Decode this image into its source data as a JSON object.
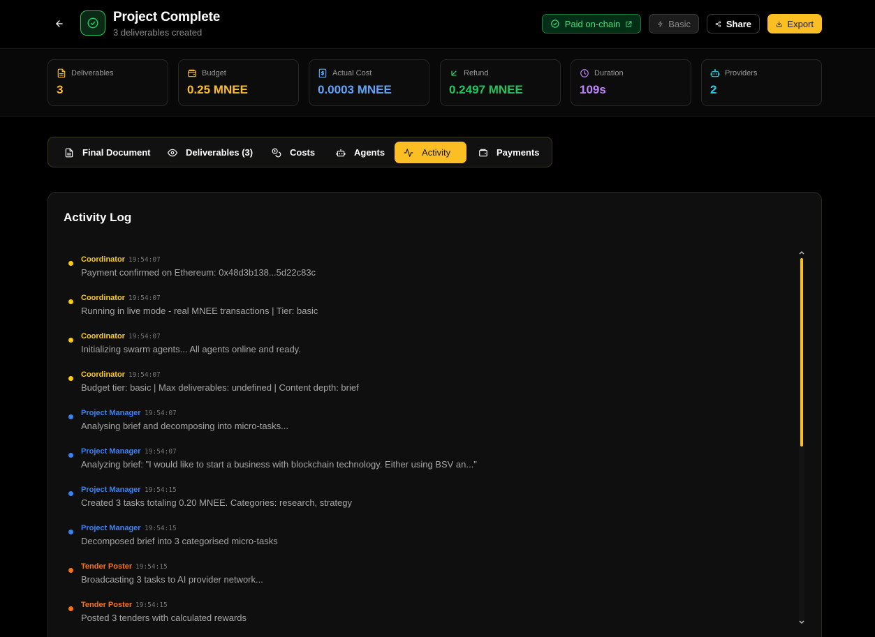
{
  "header": {
    "title": "Project Complete",
    "subtitle": "3 deliverables created",
    "paid_label": "Paid on-chain",
    "basic_label": "Basic",
    "share_label": "Share",
    "export_label": "Export"
  },
  "stats": [
    {
      "label": "Deliverables",
      "value": "3",
      "color": "#fbbf24",
      "icon": "file-icon"
    },
    {
      "label": "Budget",
      "value": "0.25 MNEE",
      "color": "#fbbf24",
      "icon": "wallet-icon"
    },
    {
      "label": "Actual Cost",
      "value": "0.0003 MNEE",
      "color": "#60a5fa",
      "icon": "receipt-icon"
    },
    {
      "label": "Refund",
      "value": "0.2497 MNEE",
      "color": "#22c55e",
      "icon": "arrow-down-left-icon"
    },
    {
      "label": "Duration",
      "value": "109s",
      "color": "#c084fc",
      "icon": "clock-icon"
    },
    {
      "label": "Providers",
      "value": "2",
      "color": "#22d3ee",
      "icon": "bot-icon"
    }
  ],
  "tabs": [
    {
      "label": "Final Document",
      "icon": "document-icon"
    },
    {
      "label": "Deliverables (3)",
      "icon": "eye-icon"
    },
    {
      "label": "Costs",
      "icon": "coins-icon"
    },
    {
      "label": "Agents",
      "icon": "bot-icon"
    },
    {
      "label": "Activity",
      "icon": "activity-icon",
      "active": true
    },
    {
      "label": "Payments",
      "icon": "wallet-icon"
    }
  ],
  "activity": {
    "title": "Activity Log",
    "entries": [
      {
        "who": "Coordinator",
        "time": "19:54:07",
        "msg": "Payment confirmed on Ethereum: 0x48d3b138...5d22c83c",
        "color": "#facc15"
      },
      {
        "who": "Coordinator",
        "time": "19:54:07",
        "msg": "Running in live mode - real MNEE transactions | Tier: basic",
        "color": "#facc15"
      },
      {
        "who": "Coordinator",
        "time": "19:54:07",
        "msg": "Initializing swarm agents... All agents online and ready.",
        "color": "#facc15"
      },
      {
        "who": "Coordinator",
        "time": "19:54:07",
        "msg": "Budget tier: basic | Max deliverables: undefined | Content depth: brief",
        "color": "#facc15"
      },
      {
        "who": "Project Manager",
        "time": "19:54:07",
        "msg": "Analysing brief and decomposing into micro-tasks...",
        "color": "#3b82f6"
      },
      {
        "who": "Project Manager",
        "time": "19:54:07",
        "msg": "Analyzing brief: \"I would like to start a business with blockchain technology. Either using BSV an...\"",
        "color": "#3b82f6"
      },
      {
        "who": "Project Manager",
        "time": "19:54:15",
        "msg": "Created 3 tasks totaling 0.20 MNEE. Categories: research, strategy",
        "color": "#3b82f6"
      },
      {
        "who": "Project Manager",
        "time": "19:54:15",
        "msg": "Decomposed brief into 3 categorised micro-tasks",
        "color": "#3b82f6"
      },
      {
        "who": "Tender Poster",
        "time": "19:54:15",
        "msg": "Broadcasting 3 tasks to AI provider network...",
        "color": "#f97316"
      },
      {
        "who": "Tender Poster",
        "time": "19:54:15",
        "msg": "Posted 3 tenders with calculated rewards",
        "color": "#f97316"
      }
    ]
  }
}
